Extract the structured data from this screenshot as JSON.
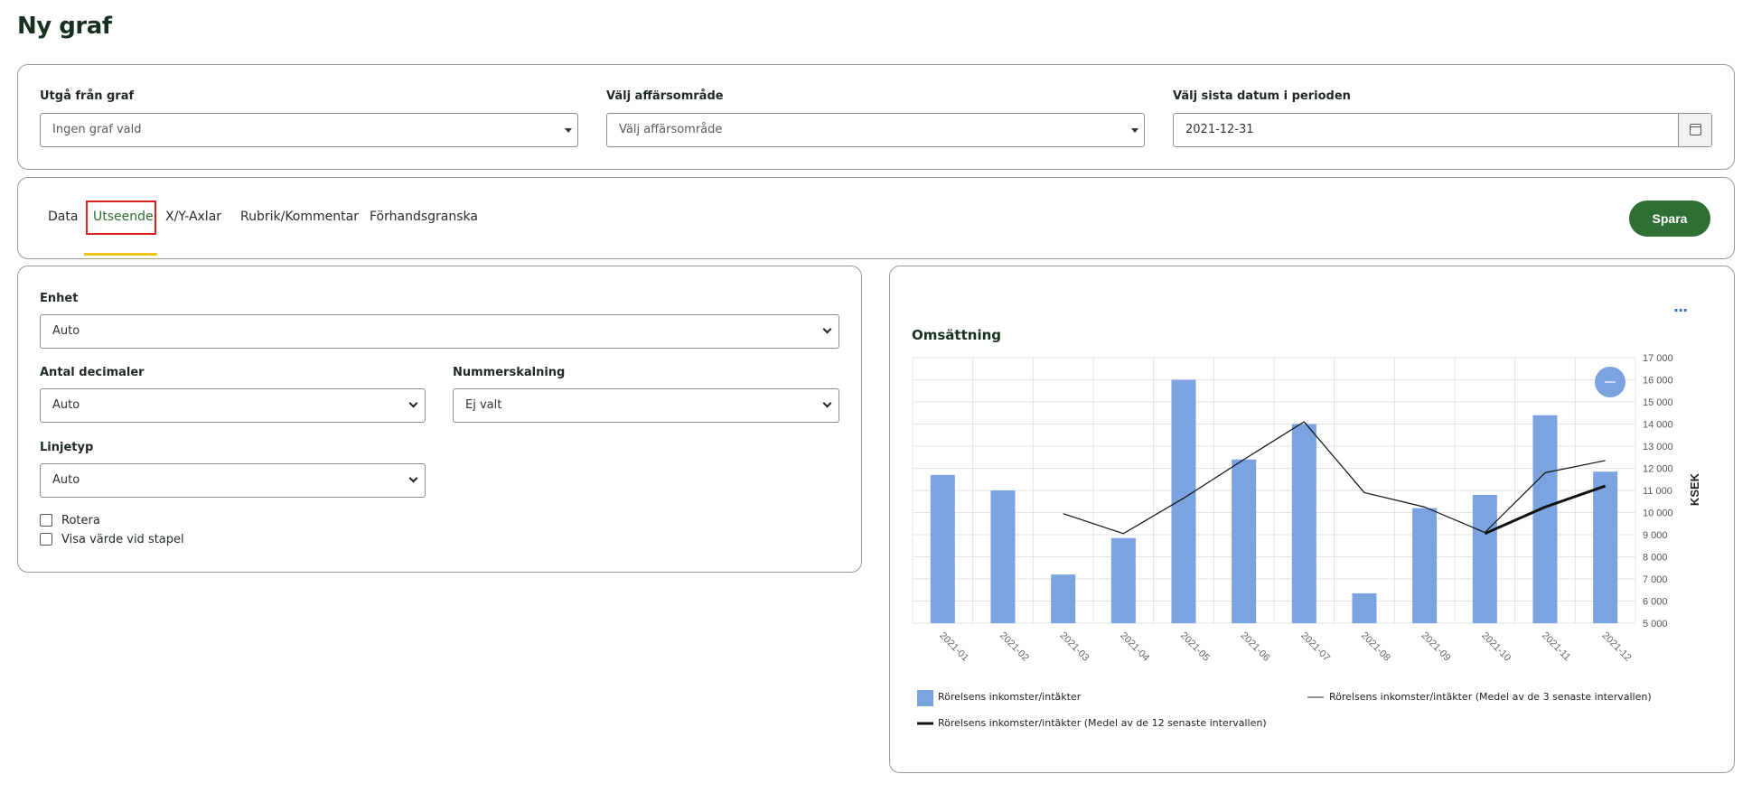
{
  "page": {
    "title": "Ny graf"
  },
  "filters": {
    "base_graph": {
      "label": "Utgå från graf",
      "value": "Ingen graf vald"
    },
    "business_area": {
      "label": "Välj affärsområde",
      "value": "Välj affärsområde"
    },
    "end_date": {
      "label": "Välj sista datum i perioden",
      "value": "2021-12-31"
    }
  },
  "tabs": [
    {
      "label": "Data"
    },
    {
      "label": "Utseende",
      "active": true
    },
    {
      "label": "X/Y-Axlar"
    },
    {
      "label": "Rubrik/Kommentar"
    },
    {
      "label": "Förhandsgranska"
    }
  ],
  "save_label": "Spara",
  "settings": {
    "unit": {
      "label": "Enhet",
      "value": "Auto"
    },
    "decimals": {
      "label": "Antal decimaler",
      "value": "Auto"
    },
    "scaling": {
      "label": "Nummerskalning",
      "value": "Ej valt"
    },
    "linetype": {
      "label": "Linjetyp",
      "value": "Auto"
    },
    "rotate": {
      "label": "Rotera",
      "checked": false
    },
    "show_value": {
      "label": "Visa värde vid stapel",
      "checked": false
    }
  },
  "chart_menu_label": "...",
  "colors": {
    "accent": "#2f6f33",
    "tab_underline": "#f0c419",
    "highlight": "#d62020",
    "bar": "#7ba3e0"
  },
  "chart_data": {
    "type": "bar",
    "title": "Omsättning",
    "ylabel": "KSEK",
    "xlabel": "",
    "ylim": [
      5000,
      17000
    ],
    "yticks": [
      "5 000",
      "6 000",
      "7 000",
      "8 000",
      "9 000",
      "10 000",
      "11 000",
      "12 000",
      "13 000",
      "14 000",
      "15 000",
      "16 000",
      "17 000"
    ],
    "categories": [
      "2021-01",
      "2021-02",
      "2021-03",
      "2021-04",
      "2021-05",
      "2021-06",
      "2021-07",
      "2021-08",
      "2021-09",
      "2021-10",
      "2021-11",
      "2021-12"
    ],
    "series": [
      {
        "name": "Rörelsens inkomster/intäkter",
        "type": "bar",
        "values": [
          11700,
          11000,
          7200,
          8850,
          16000,
          12400,
          14000,
          6350,
          10200,
          10800,
          14400,
          11850
        ]
      },
      {
        "name": "Rörelsens inkomster/intäkter (Medel av de 3 senaste intervallen)",
        "type": "line",
        "values": [
          null,
          null,
          9950,
          9050,
          10650,
          12400,
          14100,
          10900,
          10250,
          9100,
          11800,
          12350
        ]
      },
      {
        "name": "Rörelsens inkomster/intäkter (Medel av de 12 senaste intervallen)",
        "type": "line",
        "values": [
          null,
          null,
          null,
          null,
          null,
          null,
          null,
          null,
          null,
          9050,
          10250,
          11200
        ]
      }
    ],
    "grid": true,
    "legend_position": "bottom"
  }
}
